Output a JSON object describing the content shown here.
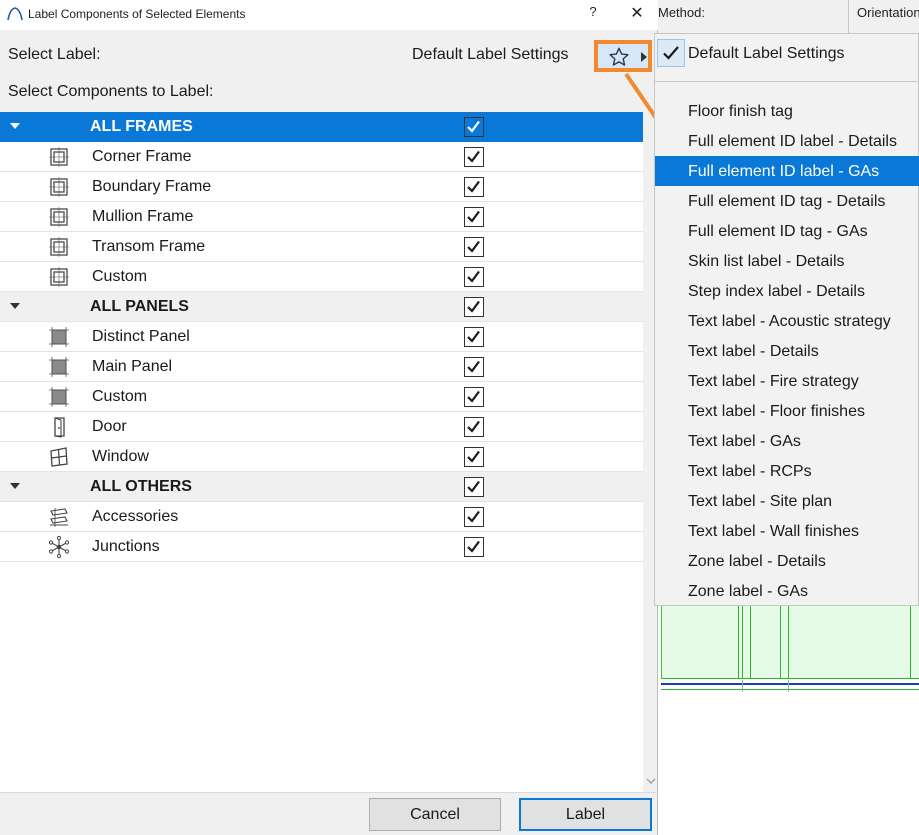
{
  "dialog": {
    "title": "Label Components of Selected Elements",
    "help_glyph": "?",
    "close_glyph": "✕",
    "select_label": "Select Label:",
    "select_value": "Default Label Settings",
    "components_label": "Select Components to Label:",
    "cancel_label": "Cancel",
    "label_button": "Label"
  },
  "tree": {
    "groups": [
      {
        "label": "ALL FRAMES",
        "checked": true,
        "selected": true,
        "items": [
          {
            "label": "Corner Frame",
            "icon": "frame-icon",
            "checked": true
          },
          {
            "label": "Boundary Frame",
            "icon": "frame-icon",
            "checked": true
          },
          {
            "label": "Mullion Frame",
            "icon": "frame-icon",
            "checked": true
          },
          {
            "label": "Transom Frame",
            "icon": "frame-icon",
            "checked": true
          },
          {
            "label": "Custom",
            "icon": "frame-icon",
            "checked": true
          }
        ]
      },
      {
        "label": "ALL PANELS",
        "checked": true,
        "selected": false,
        "items": [
          {
            "label": "Distinct Panel",
            "icon": "panel-icon",
            "checked": true
          },
          {
            "label": "Main Panel",
            "icon": "panel-icon",
            "checked": true
          },
          {
            "label": "Custom",
            "icon": "panel-icon",
            "checked": true
          },
          {
            "label": "Door",
            "icon": "door-icon",
            "checked": true
          },
          {
            "label": "Window",
            "icon": "window-icon",
            "checked": true
          }
        ]
      },
      {
        "label": "ALL OTHERS",
        "checked": true,
        "selected": false,
        "items": [
          {
            "label": "Accessories",
            "icon": "accessories-icon",
            "checked": true
          },
          {
            "label": "Junctions",
            "icon": "junction-icon",
            "checked": true
          }
        ]
      }
    ]
  },
  "menu": {
    "checked_item": "Default Label Settings",
    "items": [
      "Floor finish tag",
      "Full element ID label - Details",
      "Full element ID label - GAs",
      "Full element ID tag - Details",
      "Full element ID tag - GAs",
      "Skin list label - Details",
      "Step index label - Details",
      "Text label - Acoustic strategy",
      "Text label - Details",
      "Text label - Fire strategy",
      "Text label - Floor finishes",
      "Text label - GAs",
      "Text label - RCPs",
      "Text label - Site plan",
      "Text label - Wall finishes",
      "Zone label - Details",
      "Zone label - GAs"
    ],
    "highlighted_index": 2
  },
  "background": {
    "method_header": "Method:",
    "orientation_header": "Orientation"
  },
  "colors": {
    "accent": "#0a78d7",
    "highlight_outline": "#f3892e",
    "dialog_bg": "#f0f0f0"
  }
}
